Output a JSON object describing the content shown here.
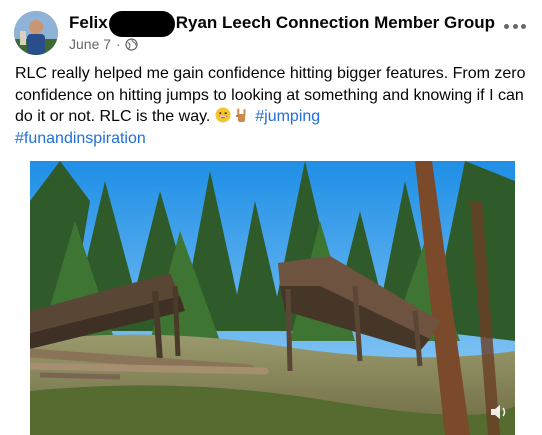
{
  "post": {
    "author_name": "Felix",
    "group_name": "Ryan Leech Connection Member Group",
    "date": "June 7",
    "meta_separator": "·",
    "text_main": "RLC really helped me gain confidence hitting bigger features. From zero confidence on hitting jumps to looking at something and knowing if I can do it or not. RLC is the way.",
    "hashtags": [
      "#jumping",
      "#funandinspiration"
    ],
    "icons": {
      "privacy": "globe-icon",
      "more": "more-options-icon",
      "emoji_1": "grinning-face-emoji",
      "emoji_2": "rock-on-hand-emoji",
      "video_sound": "sound-icon"
    }
  },
  "colors": {
    "hashtag": "#216fdb",
    "meta_gray": "#65676b",
    "text": "#050505"
  }
}
